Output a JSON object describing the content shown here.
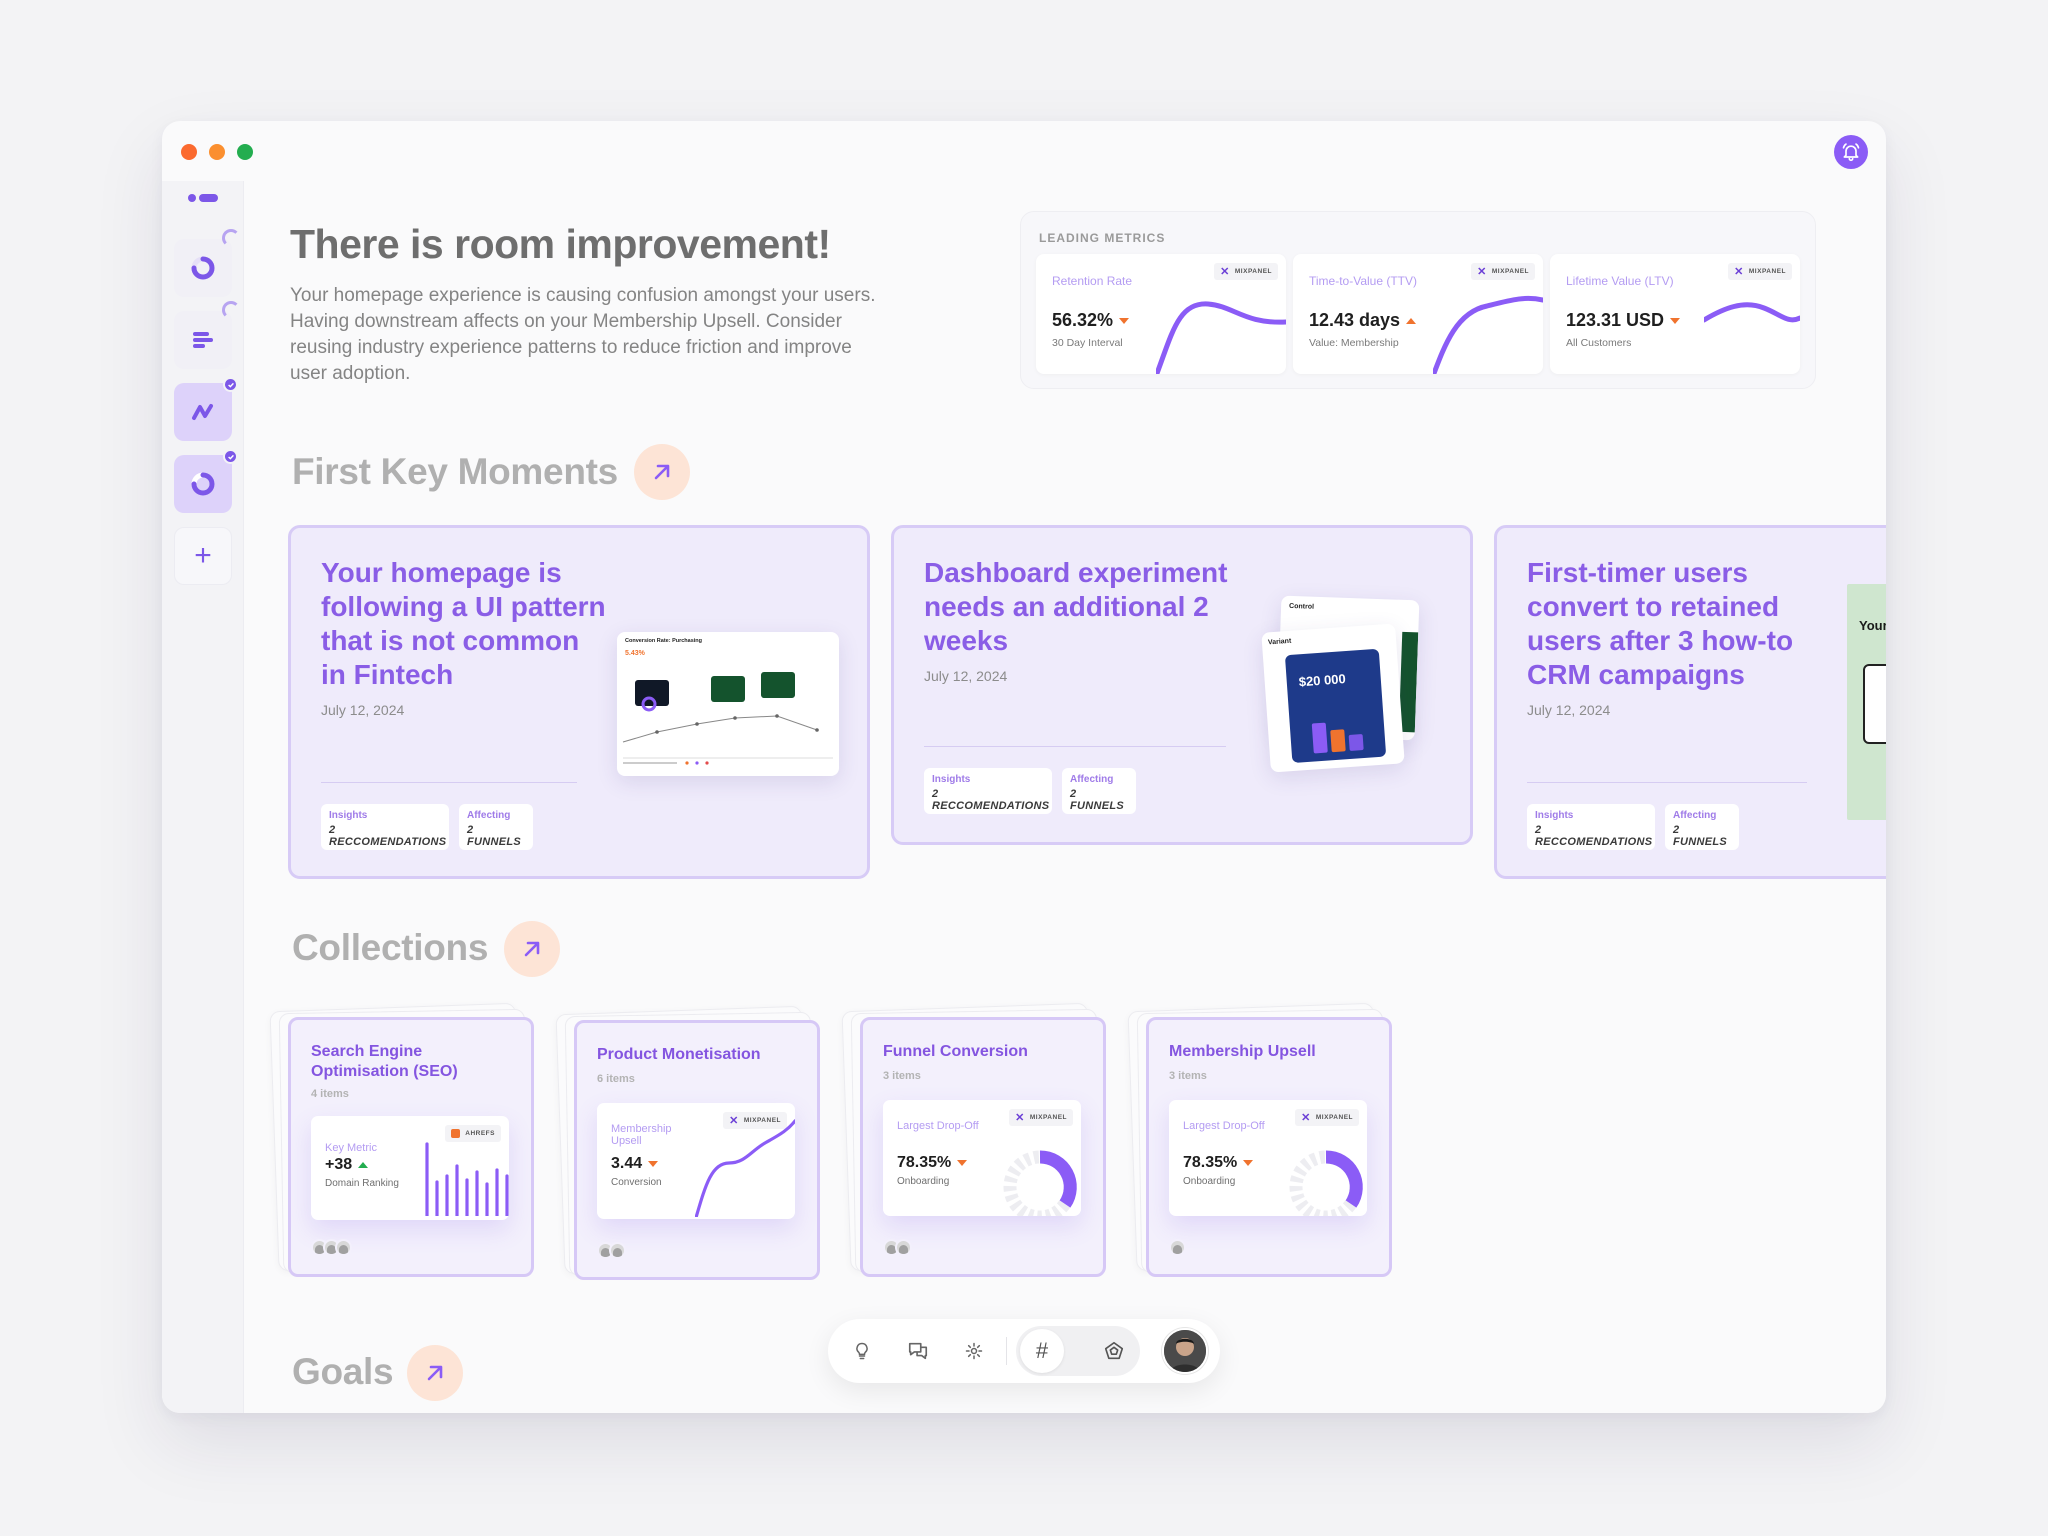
{
  "header": {
    "headline": "There is room improvement!",
    "intro": "Your homepage experience is causing confusion amongst your users. Having downstream affects on your Membership Upsell. Consider reusing industry experience patterns to reduce friction and improve user adoption."
  },
  "metrics": {
    "title": "LEADING METRICS",
    "source": "MIXPANEL",
    "cards": [
      {
        "label": "Retention Rate",
        "value": "56.32%",
        "sub": "30 Day Interval",
        "trend": "down"
      },
      {
        "label": "Time-to-Value (TTV)",
        "value": "12.43 days",
        "sub": "Value: Membership",
        "trend": "up"
      },
      {
        "label": "Lifetime Value (LTV)",
        "value": "123.31 USD",
        "sub": "All Customers",
        "trend": "down"
      }
    ]
  },
  "sections": {
    "key_moments": "First Key Moments",
    "collections": "Collections",
    "goals": "Goals"
  },
  "key_moments": [
    {
      "title": "Your homepage is following a UI pattern that is not common in Fintech",
      "date": "July 12, 2024",
      "insights_label": "Insights",
      "insights_value": "2 RECCOMENDATIONS",
      "affecting_label": "Affecting",
      "affecting_value": "2 FUNNELS"
    },
    {
      "title": "Dashboard experiment needs an additional 2 weeks",
      "date": "July 12, 2024",
      "insights_label": "Insights",
      "insights_value": "2 RECCOMENDATIONS",
      "affecting_label": "Affecting",
      "affecting_value": "2 FUNNELS"
    },
    {
      "title": "First-timer users convert to retained users after 3 how-to CRM campaigns",
      "date": "July 12, 2024",
      "insights_label": "Insights",
      "insights_value": "2 RECCOMENDATIONS",
      "affecting_label": "Affecting",
      "affecting_value": "2 FUNNELS"
    }
  ],
  "thumbs": {
    "conversion_title": "Conversion Rate: Purchasing",
    "conversion_value": "5.43%",
    "control": "Control",
    "variant": "Variant",
    "variant_amount": "$20 000",
    "third_title": "Your"
  },
  "collections": [
    {
      "title": "Search Engine Optimisation (SEO)",
      "count": "4 items",
      "source": "AHREFS",
      "label": "Key Metric",
      "value": "+38",
      "sub": "Domain Ranking",
      "trend": "up-green"
    },
    {
      "title": "Product Monetisation",
      "count": "6 items",
      "source": "MIXPANEL",
      "label": "Membership Upsell",
      "value": "3.44",
      "sub": "Conversion",
      "trend": "down"
    },
    {
      "title": "Funnel Conversion",
      "count": "3 items",
      "source": "MIXPANEL",
      "label": "Largest Drop-Off",
      "value": "78.35%",
      "sub": "Onboarding",
      "trend": "down"
    },
    {
      "title": "Membership Upsell",
      "count": "3 items",
      "source": "MIXPANEL",
      "label": "Largest Drop-Off",
      "value": "78.35%",
      "sub": "Onboarding",
      "trend": "down"
    }
  ],
  "toolbar": {
    "hash": "#"
  },
  "colors": {
    "accent": "#8b5cf6",
    "accent_text": "#8a5de6",
    "warning": "#f0732e",
    "positive": "#23ad4f"
  }
}
